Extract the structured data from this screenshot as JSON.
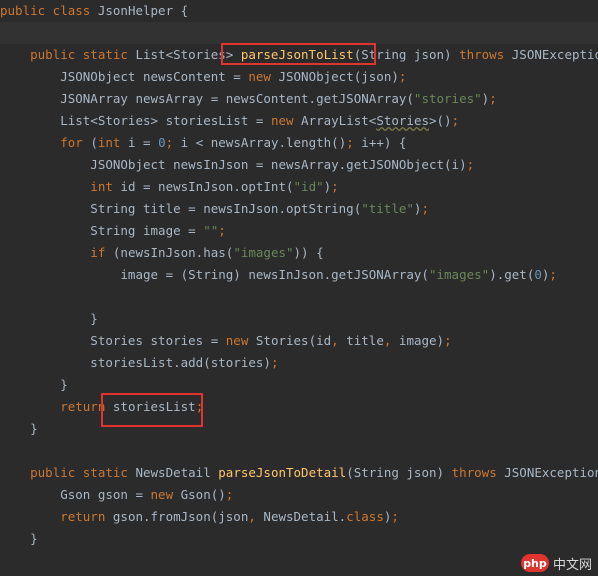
{
  "editor": {
    "lines": [
      [
        {
          "t": "public class ",
          "c": "kw"
        },
        {
          "t": "JsonHelper {",
          "c": "plain"
        }
      ],
      [],
      [
        {
          "t": "    public static ",
          "c": "kw"
        },
        {
          "t": "List<Stories> ",
          "c": "plain"
        },
        {
          "t": "parseJsonToList",
          "c": "fn"
        },
        {
          "t": "(String json) ",
          "c": "plain"
        },
        {
          "t": "throws ",
          "c": "kw"
        },
        {
          "t": "JSONException {",
          "c": "plain"
        }
      ],
      [
        {
          "t": "        JSONObject newsContent = ",
          "c": "plain"
        },
        {
          "t": "new ",
          "c": "kw"
        },
        {
          "t": "JSONObject(json)",
          "c": "plain"
        },
        {
          "t": ";",
          "c": "punc"
        }
      ],
      [
        {
          "t": "        JSONArray newsArray = newsContent.getJSONArray(",
          "c": "plain"
        },
        {
          "t": "\"stories\"",
          "c": "str"
        },
        {
          "t": ")",
          "c": "plain"
        },
        {
          "t": ";",
          "c": "punc"
        }
      ],
      [
        {
          "t": "        List<Stories> storiesList = ",
          "c": "plain"
        },
        {
          "t": "new ",
          "c": "kw"
        },
        {
          "t": "ArrayList<",
          "c": "plain"
        },
        {
          "t": "Stories",
          "c": "plain under"
        },
        {
          "t": ">()",
          "c": "plain"
        },
        {
          "t": ";",
          "c": "punc"
        }
      ],
      [
        {
          "t": "        for ",
          "c": "kw"
        },
        {
          "t": "(",
          "c": "plain"
        },
        {
          "t": "int ",
          "c": "kw"
        },
        {
          "t": "i = ",
          "c": "plain"
        },
        {
          "t": "0",
          "c": "num"
        },
        {
          "t": "; ",
          "c": "punc"
        },
        {
          "t": "i < newsArray.length()",
          "c": "plain"
        },
        {
          "t": "; ",
          "c": "punc"
        },
        {
          "t": "i++) {",
          "c": "plain"
        }
      ],
      [
        {
          "t": "            JSONObject newsInJson = newsArray.getJSONObject(i)",
          "c": "plain"
        },
        {
          "t": ";",
          "c": "punc"
        }
      ],
      [
        {
          "t": "            int ",
          "c": "kw"
        },
        {
          "t": "id = newsInJson.optInt(",
          "c": "plain"
        },
        {
          "t": "\"id\"",
          "c": "str"
        },
        {
          "t": ")",
          "c": "plain"
        },
        {
          "t": ";",
          "c": "punc"
        }
      ],
      [
        {
          "t": "            String title = newsInJson.optString(",
          "c": "plain"
        },
        {
          "t": "\"title\"",
          "c": "str"
        },
        {
          "t": ")",
          "c": "plain"
        },
        {
          "t": ";",
          "c": "punc"
        }
      ],
      [
        {
          "t": "            String image = ",
          "c": "plain"
        },
        {
          "t": "\"\"",
          "c": "str"
        },
        {
          "t": ";",
          "c": "punc"
        }
      ],
      [
        {
          "t": "            if ",
          "c": "kw"
        },
        {
          "t": "(newsInJson.has(",
          "c": "plain"
        },
        {
          "t": "\"images\"",
          "c": "str"
        },
        {
          "t": ")) {",
          "c": "plain"
        }
      ],
      [
        {
          "t": "                image = (String) newsInJson.getJSONArray(",
          "c": "plain"
        },
        {
          "t": "\"images\"",
          "c": "str"
        },
        {
          "t": ").get(",
          "c": "plain"
        },
        {
          "t": "0",
          "c": "num"
        },
        {
          "t": ")",
          "c": "plain"
        },
        {
          "t": ";",
          "c": "punc"
        }
      ],
      [],
      [
        {
          "t": "            }",
          "c": "plain"
        }
      ],
      [
        {
          "t": "            Stories stories = ",
          "c": "plain"
        },
        {
          "t": "new ",
          "c": "kw"
        },
        {
          "t": "Stories(id",
          "c": "plain"
        },
        {
          "t": ", ",
          "c": "punc"
        },
        {
          "t": "title",
          "c": "plain"
        },
        {
          "t": ", ",
          "c": "punc"
        },
        {
          "t": "image)",
          "c": "plain"
        },
        {
          "t": ";",
          "c": "punc"
        }
      ],
      [
        {
          "t": "            storiesList.add(stories)",
          "c": "plain"
        },
        {
          "t": ";",
          "c": "punc"
        }
      ],
      [
        {
          "t": "        }",
          "c": "plain"
        }
      ],
      [
        {
          "t": "        return ",
          "c": "kw"
        },
        {
          "t": "storiesList",
          "c": "plain"
        },
        {
          "t": ";",
          "c": "punc"
        }
      ],
      [
        {
          "t": "    }",
          "c": "plain"
        }
      ],
      [],
      [
        {
          "t": "    public static ",
          "c": "kw"
        },
        {
          "t": "NewsDetail ",
          "c": "plain"
        },
        {
          "t": "parseJsonToDetail",
          "c": "fn"
        },
        {
          "t": "(String json) ",
          "c": "plain"
        },
        {
          "t": "throws ",
          "c": "kw"
        },
        {
          "t": "JSONException {",
          "c": "plain"
        }
      ],
      [
        {
          "t": "        Gson gson = ",
          "c": "plain"
        },
        {
          "t": "new ",
          "c": "kw"
        },
        {
          "t": "Gson()",
          "c": "plain"
        },
        {
          "t": ";",
          "c": "punc"
        }
      ],
      [
        {
          "t": "        return ",
          "c": "kw"
        },
        {
          "t": "gson.fromJson(json",
          "c": "plain"
        },
        {
          "t": ", ",
          "c": "punc"
        },
        {
          "t": "NewsDetail.",
          "c": "plain"
        },
        {
          "t": "class",
          "c": "kw"
        },
        {
          "t": ")",
          "c": "plain"
        },
        {
          "t": ";",
          "c": "punc"
        }
      ],
      [
        {
          "t": "    }",
          "c": "plain"
        }
      ]
    ]
  },
  "watermark": {
    "logo_text": "php",
    "site_text": "中文网"
  },
  "colors": {
    "background": "#2b2b2b",
    "keyword": "#cc7832",
    "string": "#6a8759",
    "method": "#ffc66d",
    "number": "#6897bb",
    "text": "#a9b7c6",
    "annotation_box": "#e0352e"
  }
}
